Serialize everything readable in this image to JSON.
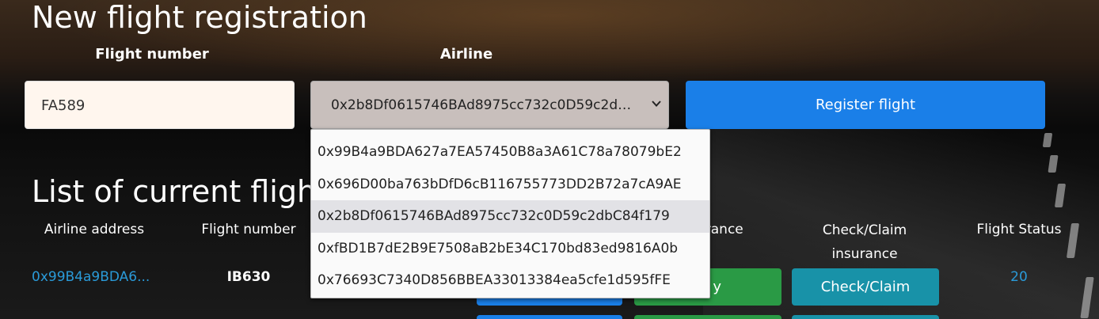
{
  "registration": {
    "title": "New flight registration",
    "flight_label": "Flight number",
    "airline_label": "Airline",
    "flight_value": "FA589",
    "airline_selected": "0x2b8Df0615746BAd8975cc732c0D59c2dbC84f179",
    "register_button": "Register flight"
  },
  "airline_options": [
    "0x99B4a9BDA627a7EA57450B8a3A61C78a78079bE2",
    "0x696D00ba763bDfD6cB116755773DD2B72a7cA9AE",
    "0x2b8Df0615746BAd8975cc732c0D59c2dbC84f179",
    "0xfBD1B7dE2B9E7508aB2bE34C170bd83ed9816A0b",
    "0x76693C7340D856BBEA33013384ea5cfe1d595fFE"
  ],
  "flights": {
    "title": "List of current flights",
    "columns": {
      "airline": "Airline address",
      "flight": "Flight number",
      "insurance": "urance",
      "check": "Check/Claim insurance",
      "status": "Flight Status"
    },
    "rows": [
      {
        "airline": "0x99B4a9BDA6...",
        "flight": "IB630",
        "buy_partial": "y",
        "check": "Check/Claim",
        "status": "20"
      }
    ]
  },
  "colors": {
    "primary": "#1a7fe8",
    "success": "#2a9a45",
    "info": "#1892a8",
    "link": "#2a9ad8"
  }
}
